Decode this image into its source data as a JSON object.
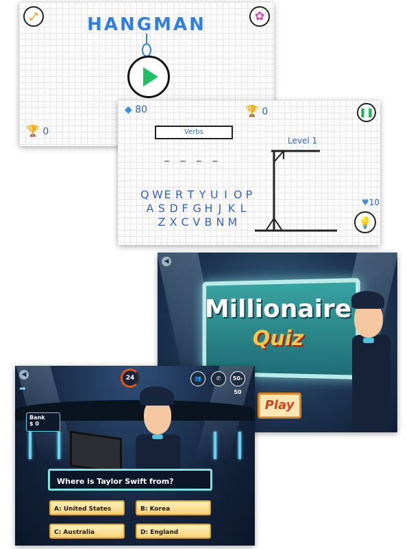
{
  "hangman_menu": {
    "title": "HANGMAN",
    "score": "0",
    "icons": {
      "expand": "expand-icon",
      "settings": "gear-icon",
      "play": "play-icon",
      "trophy": "trophy-icon"
    }
  },
  "hangman_game": {
    "gems": "80",
    "score": "0",
    "category": "Verbs",
    "blanks": "_ _ _ _",
    "level": "Level 1",
    "hints": "10",
    "keyboard_rows": [
      [
        "Q",
        "W",
        "E",
        "R",
        "T",
        "Y",
        "U",
        "I",
        "O",
        "P"
      ],
      [
        "A",
        "S",
        "D",
        "F",
        "G",
        "H",
        "J",
        "K",
        "L"
      ],
      [
        "Z",
        "X",
        "C",
        "V",
        "B",
        "N",
        "M"
      ]
    ]
  },
  "millionaire_title": {
    "title_line1": "Millionaire",
    "title_line2": "Quiz",
    "play_label": "Play"
  },
  "millionaire_game": {
    "timer": "24",
    "lifeline_fifty": "50-50",
    "bank_label": "Bank",
    "bank_value": "$ 0",
    "question": "Where is Taylor Swift from?",
    "answers": [
      "A: United States",
      "B: Korea",
      "C: Australia",
      "D: England"
    ]
  },
  "colors": {
    "hangman_ink": "#3a63b8",
    "play_green": "#22c065",
    "quiz_teal": "#7fe3e0",
    "answer_gold": "#f5d27a"
  }
}
